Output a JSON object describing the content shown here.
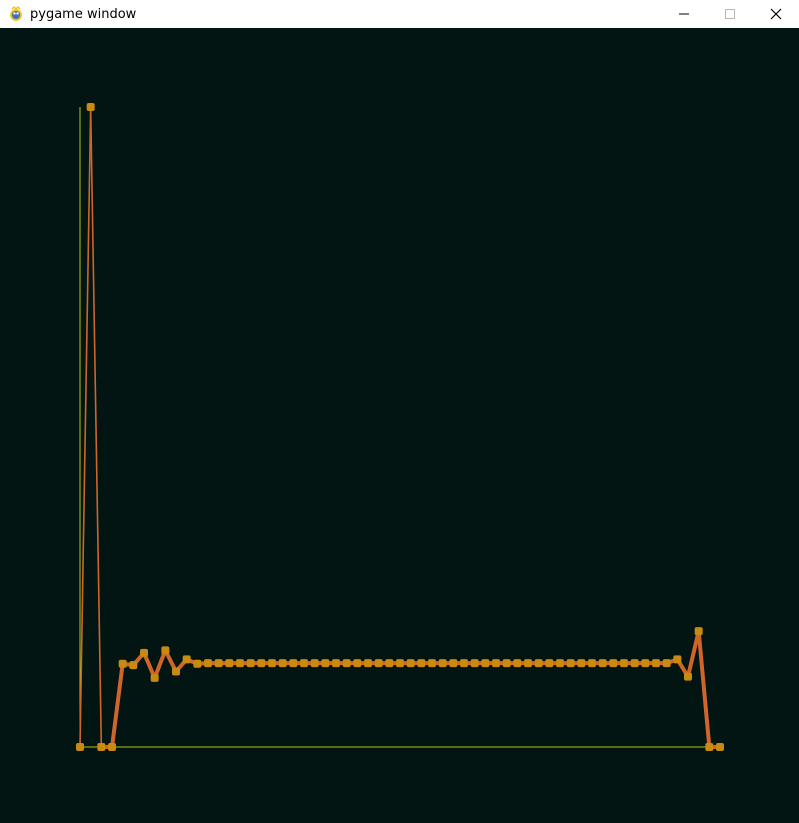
{
  "window": {
    "title": "pygame window",
    "icon": "pygame-snake-icon",
    "controls": [
      "minimize-icon",
      "maximize-icon",
      "close-icon"
    ]
  },
  "colors": {
    "background": "#021513",
    "axis": "#b5c21a",
    "line": "#d0652a",
    "marker": "#c88a10"
  },
  "chart_data": {
    "type": "line",
    "x": [
      0,
      1,
      2,
      3,
      4,
      5,
      6,
      7,
      8,
      9,
      10,
      11,
      12,
      13,
      14,
      15,
      16,
      17,
      18,
      19,
      20,
      21,
      22,
      23,
      24,
      25,
      26,
      27,
      28,
      29,
      30,
      31,
      32,
      33,
      34,
      35,
      36,
      37,
      38,
      39,
      40,
      41,
      42,
      43,
      44,
      45,
      46,
      47,
      48,
      49,
      50,
      51,
      52,
      53,
      54,
      55,
      56,
      57,
      58,
      59,
      60
    ],
    "values": [
      0,
      1,
      0,
      0,
      0.13,
      0.128,
      0.147,
      0.108,
      0.151,
      0.118,
      0.137,
      0.13,
      0.131,
      0.131,
      0.131,
      0.131,
      0.131,
      0.131,
      0.131,
      0.131,
      0.131,
      0.131,
      0.131,
      0.131,
      0.131,
      0.131,
      0.131,
      0.131,
      0.131,
      0.131,
      0.131,
      0.131,
      0.131,
      0.131,
      0.131,
      0.131,
      0.131,
      0.131,
      0.131,
      0.131,
      0.131,
      0.131,
      0.131,
      0.131,
      0.131,
      0.131,
      0.131,
      0.131,
      0.131,
      0.131,
      0.131,
      0.131,
      0.131,
      0.131,
      0.131,
      0.131,
      0.137,
      0.11,
      0.181,
      0,
      0
    ],
    "xlim": [
      0,
      60
    ],
    "ylim": [
      0,
      1
    ],
    "grid": false,
    "title": "",
    "xlabel": "",
    "ylabel": ""
  }
}
